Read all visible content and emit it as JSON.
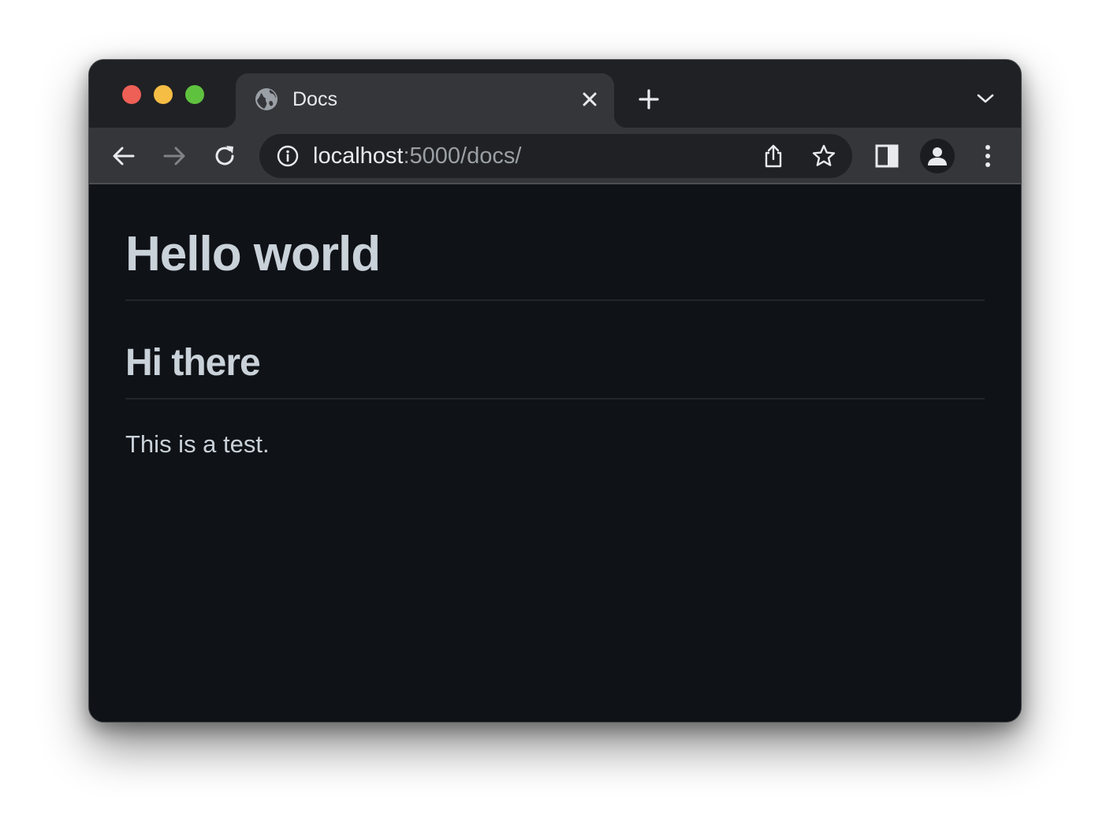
{
  "browser": {
    "tab": {
      "title": "Docs",
      "favicon": "globe-icon"
    },
    "toolbar": {
      "url_host": "localhost",
      "url_rest": ":5000/docs/"
    }
  },
  "page": {
    "heading1": "Hello world",
    "heading2": "Hi there",
    "paragraph": "This is a test."
  },
  "colors": {
    "page_background": "#0f1216",
    "text": "#c9d1d9",
    "titlebar": "#202124",
    "toolbar": "#35363a"
  }
}
